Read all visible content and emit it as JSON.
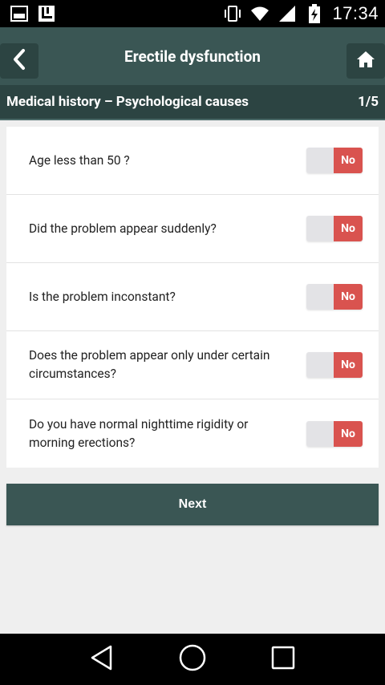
{
  "status_bar": {
    "time": "17:34",
    "icons": [
      "gallery-icon",
      "app-notification-icon",
      "vibrate-icon",
      "wifi-icon",
      "signal-icon",
      "battery-charging-icon"
    ]
  },
  "app_bar": {
    "title": "Erectile dysfunction",
    "back_icon": "chevron-left-icon",
    "home_icon": "home-icon"
  },
  "section": {
    "title": "Medical history – Psychological causes",
    "progress": "1/5"
  },
  "questions": [
    {
      "text": "Age less than 50 ?",
      "answer": "No"
    },
    {
      "text": "Did the problem appear suddenly?",
      "answer": "No"
    },
    {
      "text": "Is the problem inconstant?",
      "answer": "No"
    },
    {
      "text": "Does the problem appear only under certain circumstances?",
      "answer": "No"
    },
    {
      "text": "Do you have normal nighttime rigidity or morning erections?",
      "answer": "No"
    }
  ],
  "next_label": "Next",
  "colors": {
    "primary": "#3a5654",
    "primary_dark": "#2c4442",
    "toggle_no": "#d9534f",
    "background": "#efefef"
  }
}
